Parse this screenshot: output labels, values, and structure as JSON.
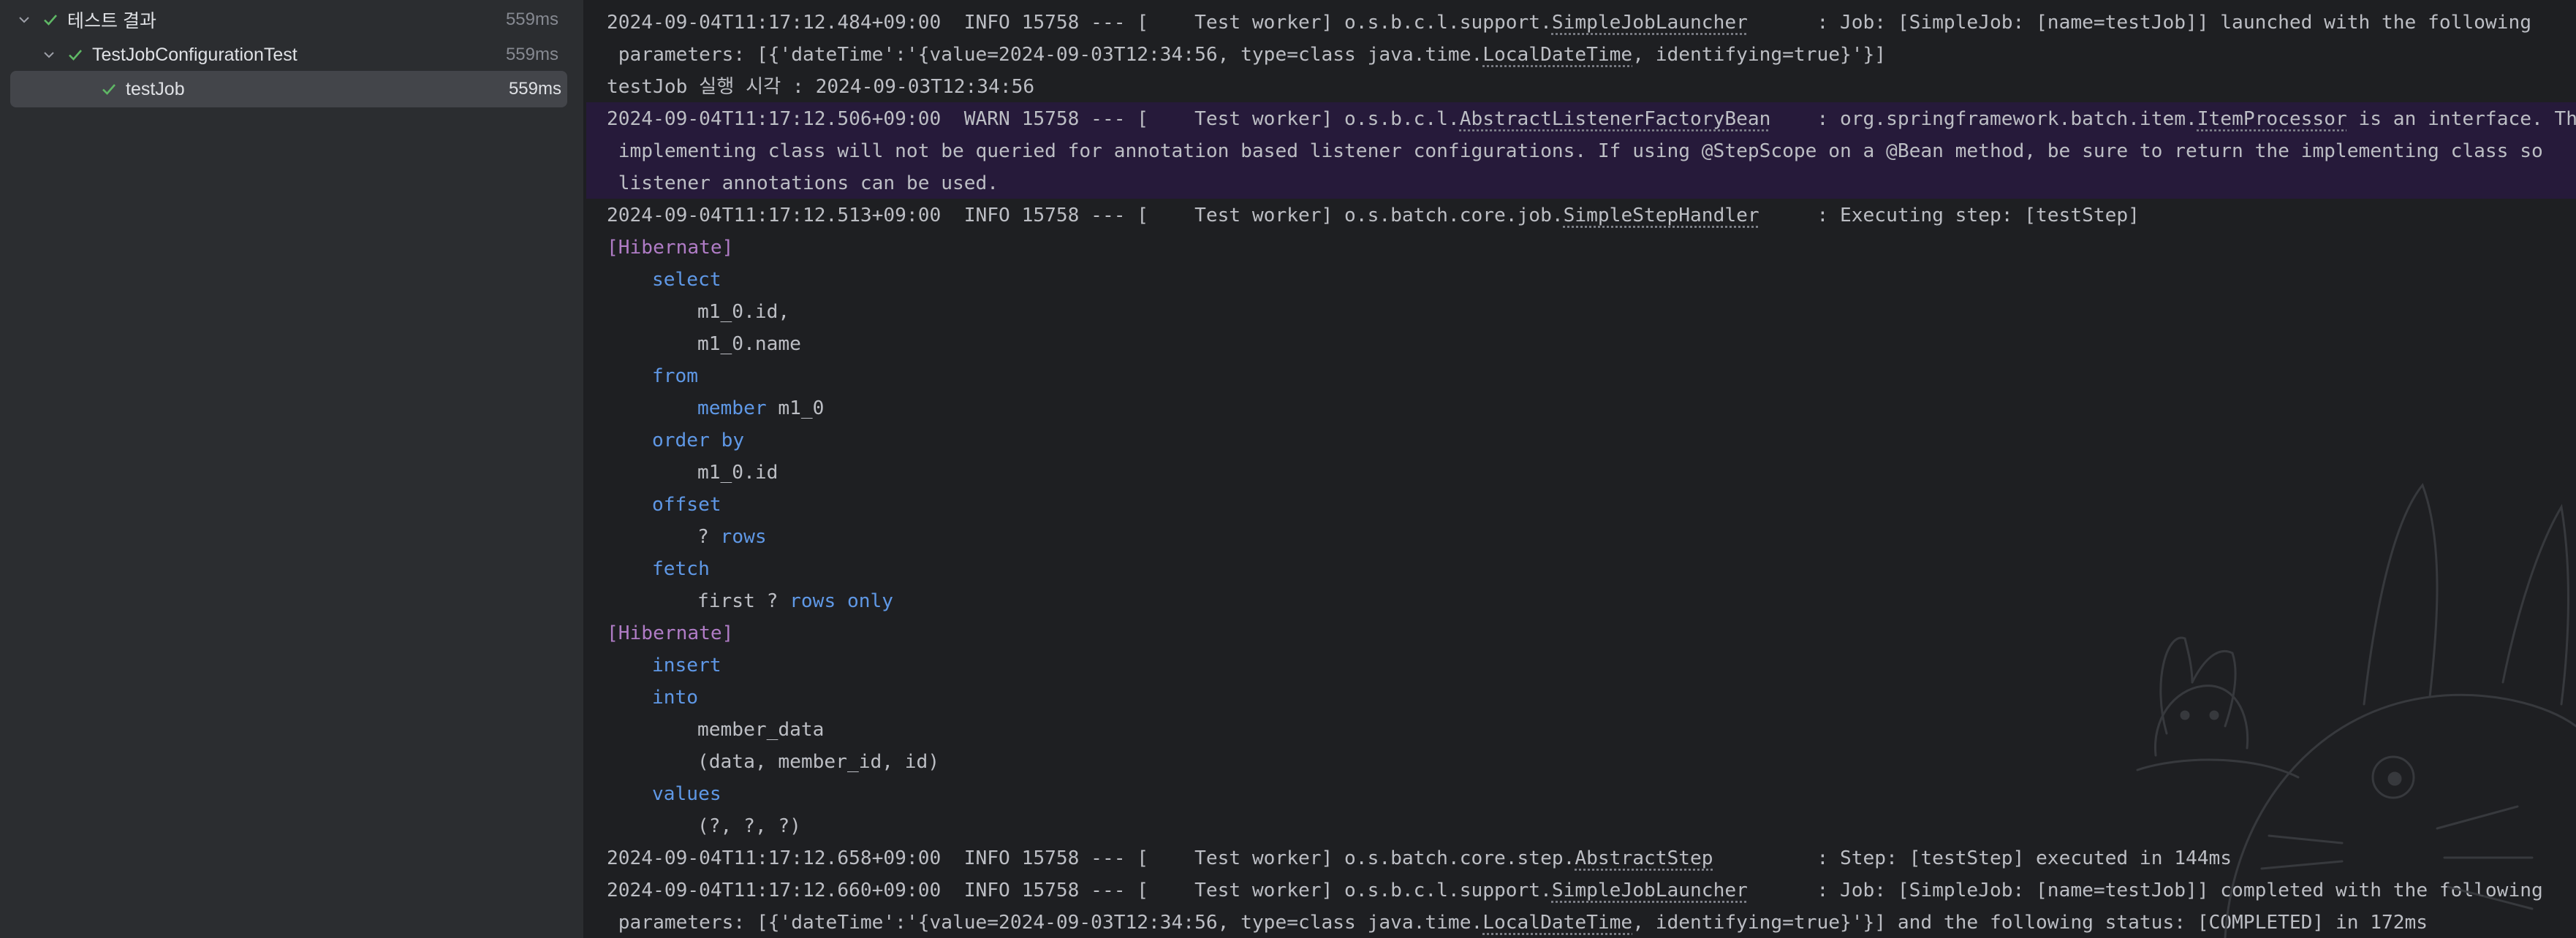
{
  "tree": {
    "root": {
      "label": "테스트 결과",
      "duration": "559ms"
    },
    "suite": {
      "label": "TestJobConfigurationTest",
      "duration": "559ms"
    },
    "test": {
      "label": "testJob",
      "duration": "559ms"
    }
  },
  "console": {
    "l1": {
      "pre": "2024-09-04T11:17:12.484+09:00  INFO 15758 --- [    Test worker] o.s.b.c.l.support.",
      "cls": "SimpleJobLauncher",
      "post": "      : Job: [SimpleJob: [name=testJob]] launched with the following"
    },
    "l2": {
      "pre": " parameters: [{'dateTime':'{value=2024-09-03T12:34:56, type=class java.time.",
      "cls": "LocalDateTime",
      "post": ", identifying=true}'}]"
    },
    "l3": "testJob 실행 시각 : 2024-09-03T12:34:56",
    "l4": {
      "pre": "2024-09-04T11:17:12.506+09:00  WARN 15758 --- [    Test worker] o.s.b.c.l.",
      "cls": "AbstractListenerFactoryBean",
      "mid": "    : org.springframework.batch.item.",
      "cls2": "ItemProcessor",
      "post": " is an interface. The"
    },
    "l5": " implementing class will not be queried for annotation based listener configurations. If using @StepScope on a @Bean method, be sure to return the implementing class so",
    "l6": " listener annotations can be used.",
    "l7": {
      "pre": "2024-09-04T11:17:12.513+09:00  INFO 15758 --- [    Test worker] o.s.batch.core.job.",
      "cls": "SimpleStepHandler",
      "post": "     : Executing step: [testStep]"
    },
    "hibernate": "[Hibernate]",
    "sql1": {
      "select": "select",
      "col1": "m1_0.id,",
      "col2": "m1_0.name",
      "from": "from",
      "table": "member",
      "alias": " m1_0",
      "orderby": "order by",
      "ordercol": "m1_0.id",
      "offset": "offset",
      "q": "? ",
      "rows": "rows",
      "fetch": "fetch",
      "first": "first ? ",
      "rowsonly": "rows only"
    },
    "sql2": {
      "insert": "insert",
      "into": "into",
      "table": "member_data",
      "cols": "(data, member_id, id)",
      "values": "values",
      "params": "(?, ?, ?)"
    },
    "l8": {
      "pre": "2024-09-04T11:17:12.658+09:00  INFO 15758 --- [    Test worker] o.s.batch.core.step.",
      "cls": "AbstractStep",
      "post": "         : Step: [testStep] executed in 144ms"
    },
    "l9": {
      "pre": "2024-09-04T11:17:12.660+09:00  INFO 15758 --- [    Test worker] o.s.b.c.l.support.",
      "cls": "SimpleJobLauncher",
      "post": "      : Job: [SimpleJob: [name=testJob]] completed with the following"
    },
    "l10": {
      "pre": " parameters: [{'dateTime':'{value=2024-09-03T12:34:56, type=class java.time.",
      "cls": "LocalDateTime",
      "post": ", identifying=true}'}] and the following status: [COMPLETED] in 172ms"
    }
  },
  "colors": {
    "bg": "#1e1f22",
    "panel": "#2b2d30",
    "selected": "#43454a",
    "pass": "#5fb865",
    "keyword": "#5f98e6",
    "hibernate": "#b07cc6",
    "warn_bg": "#261a3a"
  },
  "icons": {
    "expand": "chevron-down-icon",
    "passed": "check-icon",
    "watermark": "totoro-icon"
  }
}
